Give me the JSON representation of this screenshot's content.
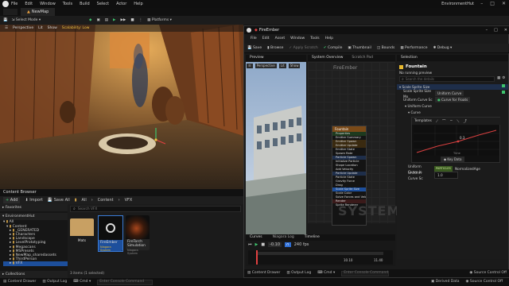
{
  "editor": {
    "menu": [
      "File",
      "Edit",
      "Window",
      "Tools",
      "Build",
      "Select",
      "Actor",
      "Help"
    ],
    "window_title": "EnvironmentHut",
    "level_tab": "NewMap",
    "toolbar": {
      "select_mode": "Select Mode",
      "platforms": "Platforms"
    }
  },
  "viewport": {
    "buttons": [
      "Perspective",
      "Lit",
      "Show"
    ],
    "scalability": "Scalability: Low"
  },
  "content_browser": {
    "tab": "Content Browser",
    "add": "Add",
    "import": "Import",
    "save_all": "Save All",
    "breadcrumb": [
      "All",
      "Content",
      "VFX"
    ],
    "search_placeholder": "Search VFX",
    "favorites": "Favorites",
    "project": "EnvironmentHut",
    "tree": [
      "All",
      "Content",
      "_GENERATED",
      "Characters",
      "Landscape",
      "LevelPrototyping",
      "Megascans",
      "MSPresets",
      "NewMap_sharedassets",
      "ThirdPerson",
      "VFX"
    ],
    "assets": [
      {
        "name": "Mats",
        "sub": ""
      },
      {
        "name": "FireEmber",
        "sub": "Niagara System"
      },
      {
        "name": "FireTorch Simulation",
        "sub": "Niagara System"
      }
    ],
    "count": "3 items (1 selected)",
    "collections": "Collections"
  },
  "bottom_bar": {
    "content_drawer": "Content Drawer",
    "output_log": "Output Log",
    "cmd": "Cmd",
    "cmd_placeholder": "Enter Console Command",
    "derived_data": "Derived Data",
    "source_control": "Source Control Off"
  },
  "niagara": {
    "tab": "FireEmber",
    "menu": [
      "File",
      "Edit",
      "Asset",
      "Window",
      "Tools",
      "Help"
    ],
    "toolbar": [
      "Save",
      "Browse",
      "Apply Scratch",
      "Compile",
      "Thumbnail",
      "Bounds",
      "Performance",
      "Debug"
    ],
    "preview_tab": "Preview",
    "preview_buttons": [
      "Perspective",
      "Lit",
      "Show"
    ],
    "system_overview_tab": "System Overview",
    "scratch_pad_tab": "Scratch Pad",
    "system_name": "FireEmber",
    "watermark": "SYSTEM",
    "node_title": "Fountain",
    "node_rows": [
      "Properties",
      "Emitter Summary",
      "Emitter Spawn",
      "Emitter Update",
      "Emitter State",
      "Spawn Rate",
      "Particle Spawn",
      "Initialize Particle",
      "Shape Location",
      "Add Velocity",
      "Particle Update",
      "Particle State",
      "Gravity Force",
      "Drag",
      "Scale Sprite Size",
      "Scale Color",
      "Solve Forces and Velocity",
      "Render",
      "Sprite Renderer"
    ],
    "selection_tab": "Selection",
    "selection_title": "Fountain",
    "no_preview": "No running preview",
    "search_details": "Search the details",
    "module": "Scale Sprite Size",
    "fields": [
      {
        "label": "Scale Sprite Size Mo",
        "value": "Uniform Curve"
      },
      {
        "label": "Uniform Curve Sc",
        "value": "Curve for Floats"
      },
      {
        "label": "Uniform Curve",
        "value": ""
      },
      {
        "label": "Curve",
        "value": ""
      }
    ],
    "templates": "Templates",
    "curve_value": "0.3",
    "time_label": "Time",
    "key_data": "Key Data",
    "curve_index_label": "Uniform Curve In",
    "curve_index_value": "PARTICLES",
    "curve_index_extra": "NormalizedAge",
    "curve_scale_label": "Uniform Curve Sc",
    "curve_scale_value": "1.0",
    "curves_tab": "Curves",
    "niagara_log_tab": "Niagara Log",
    "timeline_tab": "Timeline",
    "fps": "240 fps",
    "time_start": "-0.10",
    "time_end": "10.10",
    "time_total": "11.40",
    "status": [
      "Content Drawer",
      "Output Log",
      "Cmd"
    ],
    "console_placeholder": "Enter Console Command",
    "source_control": "Source Control Off"
  },
  "colors": {
    "accent": "#2f6fd6",
    "emitter_yellow": "#e8b92f",
    "selected_blue": "#1d4f9c"
  }
}
